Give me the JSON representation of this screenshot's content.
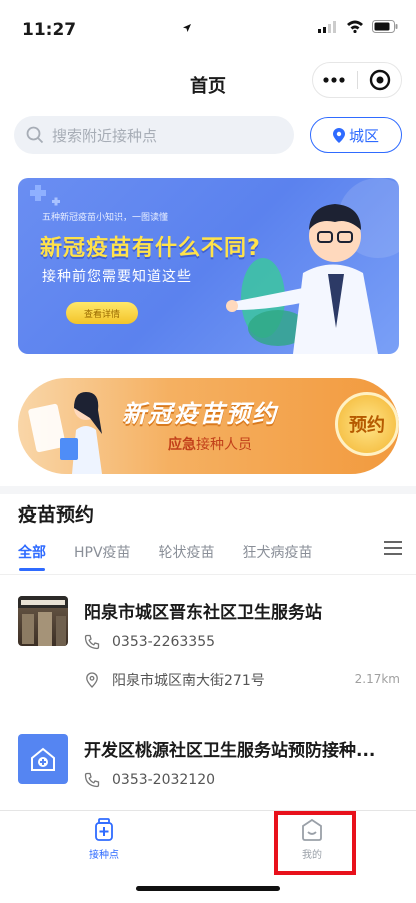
{
  "status_bar": {
    "time": "11:27"
  },
  "nav": {
    "title": "首页"
  },
  "search": {
    "placeholder": "搜索附近接种点",
    "city_label": "城区"
  },
  "banner": {
    "small_text": "五种新冠疫苗小知识，一图读懂",
    "title": "新冠疫苗有什么不同?",
    "subtitle": "接种前您需要知道这些",
    "button": "查看详情"
  },
  "appointment_banner": {
    "title": "新冠疫苗预约",
    "subtitle_urgent": "应急",
    "subtitle_rest": "接种人员",
    "button": "预约"
  },
  "section": {
    "title": "疫苗预约",
    "tabs": [
      "全部",
      "HPV疫苗",
      "轮状疫苗",
      "狂犬病疫苗"
    ]
  },
  "stations": [
    {
      "name": "阳泉市城区晋东社区卫生服务站",
      "phone": "0353-2263355",
      "address": "阳泉市城区南大街271号",
      "distance": "2.17km"
    },
    {
      "name": "开发区桃源社区卫生服务站预防接种...",
      "phone": "0353-2032120"
    }
  ],
  "tabbar": {
    "items": [
      "接种点",
      "我的"
    ]
  },
  "colors": {
    "accent": "#2f6bff",
    "highlight": "#e8111b"
  }
}
